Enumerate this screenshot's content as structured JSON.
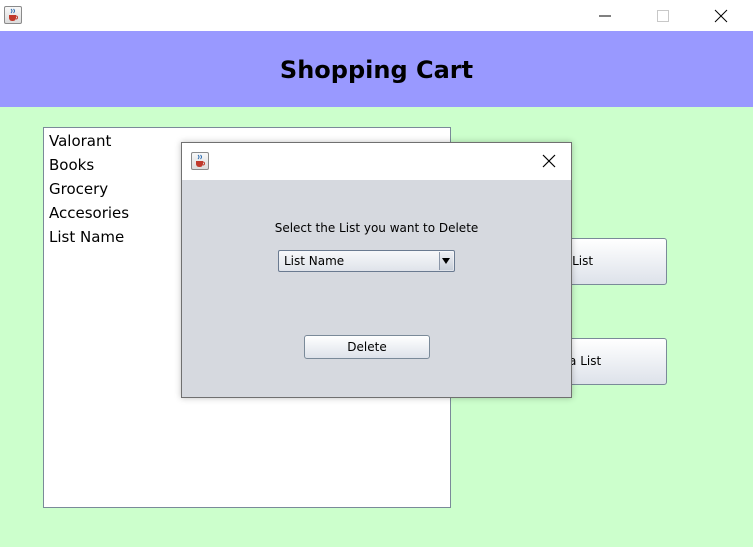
{
  "window": {
    "icon": "java-cup-icon",
    "controls": [
      "minimize-icon",
      "maximize-icon",
      "close-icon"
    ]
  },
  "header": {
    "title": "Shopping Cart",
    "background": "#9999ff"
  },
  "content": {
    "background": "#ccffcc"
  },
  "lists": {
    "items": [
      "Valorant",
      "Books",
      "Grocery",
      "Accesories",
      "List Name"
    ]
  },
  "buttons": {
    "add_label": "Add a List",
    "delete_label": "Delete a List"
  },
  "dialog": {
    "icon": "java-cup-icon",
    "prompt": "Select the List you want to Delete",
    "combo_value": "List Name",
    "delete_label": "Delete",
    "background": "#d6d9df"
  }
}
